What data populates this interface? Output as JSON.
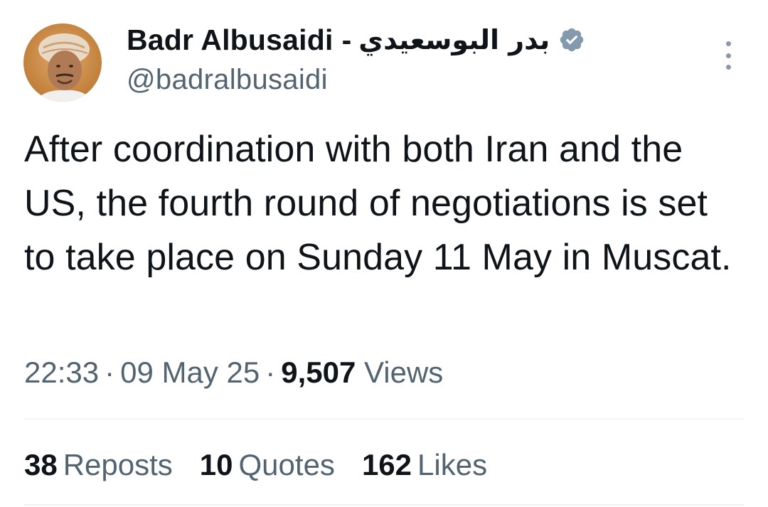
{
  "author": {
    "display_name": "Badr Albusaidi",
    "separator": "-",
    "arabic_name": "بدر البوسعيدي",
    "handle": "@badralbusaidi",
    "verified_icon": "verified-badge-icon",
    "accent_color": "#829aab"
  },
  "tweet": {
    "text": "After coordination with both Iran and the US, the fourth round of negotiations is set to take place on Sunday 11 May in Muscat.",
    "time": "22:33",
    "date": "09 May 25",
    "views_count": "9,507",
    "views_label": "Views"
  },
  "stats": {
    "reposts": {
      "count": "38",
      "label": "Reposts"
    },
    "quotes": {
      "count": "10",
      "label": "Quotes"
    },
    "likes": {
      "count": "162",
      "label": "Likes"
    }
  },
  "icons": {
    "more": "more-options-icon",
    "avatar": "avatar"
  },
  "colors": {
    "text": "#0f1419",
    "secondary": "#536471",
    "divider": "#eff3f4"
  }
}
